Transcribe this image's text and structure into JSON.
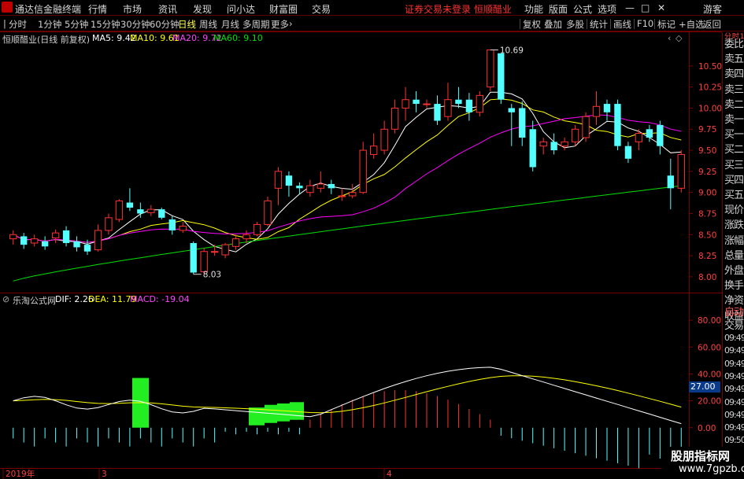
{
  "window": {
    "title": "通达信金融终端",
    "menu": [
      "行情",
      "市场",
      "资讯",
      "发现",
      "问小达",
      "财富圈",
      "交易"
    ],
    "status_text": "证券交易未登录  恒顺醋业",
    "right_menu": [
      "功能",
      "版面",
      "公式",
      "选项"
    ],
    "guest": "游客",
    "window_controls": [
      "—",
      "□",
      "✕"
    ]
  },
  "toolbar": {
    "periods": [
      "分时",
      "1分钟",
      "5分钟",
      "15分钟",
      "30分钟",
      "60分钟",
      "日线",
      "周线",
      "月线",
      "多周期",
      "更多"
    ],
    "active_period": "日线",
    "right_buttons": [
      "复权",
      "叠加",
      "多股",
      "统计",
      "画线",
      "F10",
      "标记",
      "+自选",
      "返回"
    ]
  },
  "kline": {
    "stock_title": "恒顺醋业(日线 前复权)",
    "ma5": "MA5: 9.42",
    "ma10": "MA10: 9.61",
    "ma20": "MA20: 9.72",
    "ma60": "MA60: 9.10",
    "high_label": "10.69",
    "low_label": "8.03",
    "y_ticks": [
      "10.50",
      "10.25",
      "10.00",
      "9.75",
      "9.50",
      "9.25",
      "9.00",
      "8.75",
      "8.50",
      "8.25",
      "8.00"
    ]
  },
  "macd": {
    "formula_name": "乐淘公式网",
    "dif": "DIF: 2.26",
    "dea": "DEA: 11.79",
    "macd": "MACD: -19.04",
    "y_ticks": [
      "80.00",
      "60.00",
      "40.00",
      "20.00",
      "0.00"
    ],
    "current_value": "27.00"
  },
  "x_axis": {
    "labels": [
      "2019年",
      "3",
      "4"
    ]
  },
  "right_panel": {
    "top": "分\n时\n1000",
    "items": [
      "委比",
      "卖五",
      "卖四",
      "卖三",
      "卖二",
      "卖一",
      "买一",
      "买二",
      "买三",
      "买四",
      "买五",
      "现价",
      "涨跌",
      "涨幅",
      "总量",
      "外盘",
      "换手",
      "净资",
      "收益",
      "自动",
      "交易"
    ],
    "times": [
      "09:49",
      "09:49",
      "09:49",
      "09:49",
      "09:49",
      "09:49",
      "09:49",
      "09:49",
      "09:50"
    ]
  },
  "watermark": {
    "line1": "股朋指标网",
    "line2": "www.7gpzb.com"
  },
  "colors": {
    "up": "#ff3232",
    "down": "#54ffff",
    "ma5": "#ffffff",
    "ma10": "#ffff00",
    "ma20": "#ff00ff",
    "ma60": "#00e000",
    "grid": "#7a0000"
  },
  "chart_data": [
    {
      "type": "candlestick",
      "title": "恒顺醋业(日线 前复权)",
      "ylim": [
        7.85,
        10.75
      ],
      "series_names": [
        "MA5",
        "MA10",
        "MA20",
        "MA60"
      ],
      "candles": [
        [
          8.45,
          8.5,
          8.38,
          8.55
        ],
        [
          8.48,
          8.38,
          8.33,
          8.52
        ],
        [
          8.4,
          8.45,
          8.36,
          8.5
        ],
        [
          8.42,
          8.36,
          8.32,
          8.48
        ],
        [
          8.46,
          8.52,
          8.4,
          8.56
        ],
        [
          8.55,
          8.4,
          8.36,
          8.6
        ],
        [
          8.42,
          8.35,
          8.3,
          8.48
        ],
        [
          8.38,
          8.3,
          8.26,
          8.44
        ],
        [
          8.32,
          8.55,
          8.3,
          8.62
        ],
        [
          8.55,
          8.7,
          8.5,
          8.75
        ],
        [
          8.68,
          8.9,
          8.65,
          8.92
        ],
        [
          8.88,
          8.82,
          8.78,
          9.05
        ],
        [
          8.8,
          8.75,
          8.7,
          8.88
        ],
        [
          8.76,
          8.8,
          8.72,
          8.85
        ],
        [
          8.8,
          8.7,
          8.68,
          8.82
        ],
        [
          8.68,
          8.55,
          8.5,
          8.72
        ],
        [
          8.55,
          8.6,
          8.52,
          8.65
        ],
        [
          8.4,
          8.05,
          8.03,
          8.42
        ],
        [
          8.06,
          8.3,
          8.03,
          8.34
        ],
        [
          8.3,
          8.3,
          8.25,
          8.38
        ],
        [
          8.26,
          8.38,
          8.22,
          8.4
        ],
        [
          8.36,
          8.45,
          8.32,
          8.5
        ],
        [
          8.45,
          8.5,
          8.4,
          8.55
        ],
        [
          8.5,
          8.62,
          8.48,
          8.65
        ],
        [
          8.62,
          8.9,
          8.6,
          8.95
        ],
        [
          9.05,
          9.25,
          8.85,
          9.3
        ],
        [
          9.2,
          9.08,
          8.95,
          9.25
        ],
        [
          9.08,
          9.05,
          8.98,
          9.12
        ],
        [
          9.0,
          9.08,
          8.95,
          9.15
        ],
        [
          9.05,
          9.1,
          9.0,
          9.25
        ],
        [
          9.1,
          9.05,
          8.98,
          9.15
        ],
        [
          8.95,
          8.96,
          8.9,
          9.05
        ],
        [
          8.96,
          9.0,
          8.93,
          9.1
        ],
        [
          9.0,
          9.5,
          8.98,
          9.6
        ],
        [
          9.45,
          9.55,
          9.4,
          9.7
        ],
        [
          9.5,
          9.75,
          9.45,
          9.85
        ],
        [
          9.75,
          10.0,
          9.7,
          10.1
        ],
        [
          10.0,
          10.1,
          9.85,
          10.25
        ],
        [
          10.1,
          10.05,
          9.95,
          10.2
        ],
        [
          10.05,
          10.05,
          10.0,
          10.1
        ],
        [
          10.05,
          9.85,
          9.8,
          10.15
        ],
        [
          9.9,
          10.1,
          9.85,
          10.3
        ],
        [
          10.1,
          10.05,
          10.0,
          10.25
        ],
        [
          10.1,
          9.95,
          9.85,
          10.18
        ],
        [
          9.95,
          10.15,
          9.9,
          10.2
        ],
        [
          10.25,
          10.69,
          10.2,
          10.69
        ],
        [
          10.65,
          10.1,
          10.05,
          10.6
        ],
        [
          10.0,
          9.95,
          9.55,
          10.05
        ],
        [
          10.0,
          9.65,
          9.55,
          10.08
        ],
        [
          9.75,
          9.3,
          9.25,
          9.85
        ],
        [
          9.55,
          9.6,
          9.45,
          9.65
        ],
        [
          9.6,
          9.5,
          9.45,
          9.7
        ],
        [
          9.55,
          9.6,
          9.5,
          9.65
        ],
        [
          9.6,
          9.75,
          9.55,
          9.8
        ],
        [
          9.65,
          9.9,
          9.6,
          9.95
        ],
        [
          9.9,
          10.02,
          9.8,
          10.2
        ],
        [
          10.05,
          9.95,
          9.85,
          10.1
        ],
        [
          10.05,
          9.55,
          9.5,
          10.1
        ],
        [
          9.55,
          9.4,
          9.35,
          9.6
        ],
        [
          9.6,
          9.7,
          9.5,
          9.75
        ],
        [
          9.75,
          9.65,
          9.6,
          9.8
        ],
        [
          9.8,
          9.55,
          9.45,
          9.85
        ],
        [
          9.2,
          9.05,
          8.8,
          9.4
        ],
        [
          9.05,
          9.45,
          9.0,
          9.5
        ]
      ]
    },
    {
      "type": "macd",
      "ylim": [
        -30,
        90
      ]
    }
  ]
}
